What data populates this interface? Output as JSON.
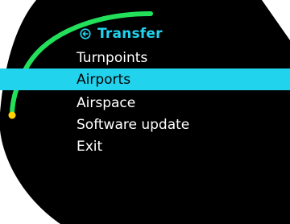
{
  "colors": {
    "screen": "#000000",
    "accent": "#22d3ee",
    "progress_arc": "#22e05a",
    "indicator_dot": "#ffd400",
    "text": "#ffffff",
    "selected_text": "#000000"
  },
  "header": {
    "back_icon": "back-arrow-circle-icon",
    "title": "Transfer"
  },
  "menu": {
    "items": [
      {
        "label": "Turnpoints",
        "selected": false
      },
      {
        "label": "Airports",
        "selected": true
      },
      {
        "label": "Airspace",
        "selected": false
      },
      {
        "label": "Software update",
        "selected": false
      },
      {
        "label": "Exit",
        "selected": false
      }
    ]
  }
}
